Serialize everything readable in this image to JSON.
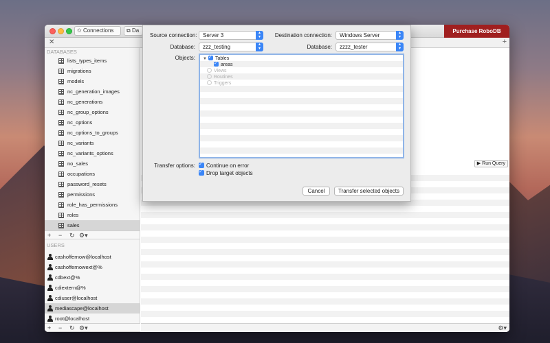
{
  "window": {
    "connections_label": "Connections",
    "second_tab_label": "Da",
    "purchase_label": "Purchase RoboDB"
  },
  "sidebar": {
    "databases_header": "DATABASES",
    "databases": [
      "lists_types_items",
      "migrations",
      "models",
      "nc_generation_images",
      "nc_generations",
      "nc_group_options",
      "nc_options",
      "nc_options_to_groups",
      "nc_variants",
      "nc_variants_options",
      "no_sales",
      "occupations",
      "password_resets",
      "permissions",
      "role_has_permissions",
      "roles",
      "sales"
    ],
    "selected_database": "sales",
    "users_header": "USERS",
    "users": [
      "cashoffernow@localhost",
      "cashoffernowext@%",
      "cdbext@%",
      "cdiextern@%",
      "cdiuser@localhost",
      "mediascape@localhost",
      "root@localhost"
    ],
    "selected_user": "mediascape@localhost"
  },
  "main": {
    "run_query_label": "Run Query"
  },
  "dialog": {
    "source_connection_label": "Source connection:",
    "source_connection_value": "Server 3",
    "destination_connection_label": "Destination connection:",
    "destination_connection_value": "Windows Server",
    "source_database_label": "Database:",
    "source_database_value": "zzz_testing",
    "destination_database_label": "Database:",
    "destination_database_value": "zzzz_tester",
    "objects_label": "Objects:",
    "tree": {
      "tables_label": "Tables",
      "tables_checked": true,
      "table_items": [
        {
          "label": "areas",
          "checked": true
        }
      ],
      "views_label": "Views",
      "routines_label": "Routines",
      "triggers_label": "Triggers"
    },
    "transfer_options_label": "Transfer options:",
    "continue_on_error_label": "Continue on error",
    "continue_on_error_checked": true,
    "drop_target_label": "Drop target objects",
    "drop_target_checked": true,
    "cancel_label": "Cancel",
    "transfer_label": "Transfer selected objects"
  }
}
